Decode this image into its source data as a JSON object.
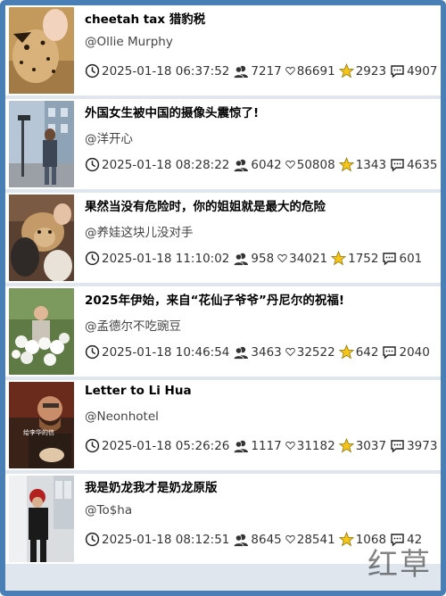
{
  "posts": [
    {
      "title": "cheetah tax 猎豹税",
      "author": "@Ollie Murphy",
      "date": "2025-01-18 06:37:52",
      "plays": "7217",
      "likes": "86691",
      "favorites": "2923",
      "comments": "4907",
      "thumb_overlay": ""
    },
    {
      "title": "外国女生被中国的摄像头震惊了!",
      "author": "@洋开心",
      "date": "2025-01-18 08:28:22",
      "plays": "6042",
      "likes": "50808",
      "favorites": "1343",
      "comments": "4635",
      "thumb_overlay": ""
    },
    {
      "title": "果然当没有危险时，你的姐姐就是最大的危险",
      "author": "@养娃这块儿没对手",
      "date": "2025-01-18 11:10:02",
      "plays": "958",
      "likes": "34021",
      "favorites": "1752",
      "comments": "601",
      "thumb_overlay": ""
    },
    {
      "title": "2025年伊始，来自“花仙子爷爷”丹尼尔的祝福!",
      "author": "@孟德尔不吃豌豆",
      "date": "2025-01-18 10:46:54",
      "plays": "3463",
      "likes": "32522",
      "favorites": "642",
      "comments": "2040",
      "thumb_overlay": ""
    },
    {
      "title": "Letter to Li Hua",
      "author": "@Neonhotel",
      "date": "2025-01-18 05:26:26",
      "plays": "1117",
      "likes": "31182",
      "favorites": "3037",
      "comments": "3973",
      "thumb_overlay": "给李华的信"
    },
    {
      "title": "我是奶龙我才是奶龙原版",
      "author": "@To$ha",
      "date": "2025-01-18 08:12:51",
      "plays": "8645",
      "likes": "28541",
      "favorites": "1068",
      "comments": "42",
      "thumb_overlay": ""
    }
  ],
  "watermark": "红草",
  "colors": {
    "frame": "#4a7fb5",
    "separator": "#dfe6ee",
    "star": "#f5c518"
  },
  "icons": {
    "date": "clock-icon",
    "plays": "users-icon",
    "likes": "heart-icon",
    "favorites": "star-icon",
    "comments": "comment-icon"
  }
}
